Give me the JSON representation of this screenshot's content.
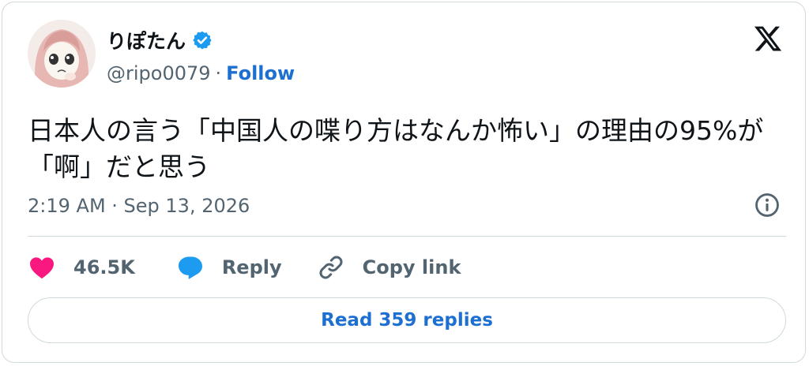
{
  "author": {
    "display_name": "りぽたん",
    "handle": "@ripo0079",
    "separator": "·",
    "follow_label": "Follow"
  },
  "tweet": {
    "text": "日本人の言う「中国人の喋り方はなんか怖い」の理由の95%が「啊」だと思う",
    "timestamp": "2:19 AM · Sep 13, 2026"
  },
  "actions": {
    "likes": "46.5K",
    "reply_label": "Reply",
    "copy_link_label": "Copy link"
  },
  "footer": {
    "read_replies_label": "Read 359 replies"
  },
  "colors": {
    "verified_badge": "#1d9bf0",
    "like_heart": "#f91880",
    "reply_bubble": "#1d9bf0",
    "link_blue": "#1d6fd1"
  },
  "icons": [
    "verified-badge-icon",
    "x-logo-icon",
    "info-icon",
    "heart-icon",
    "reply-icon",
    "link-icon"
  ]
}
